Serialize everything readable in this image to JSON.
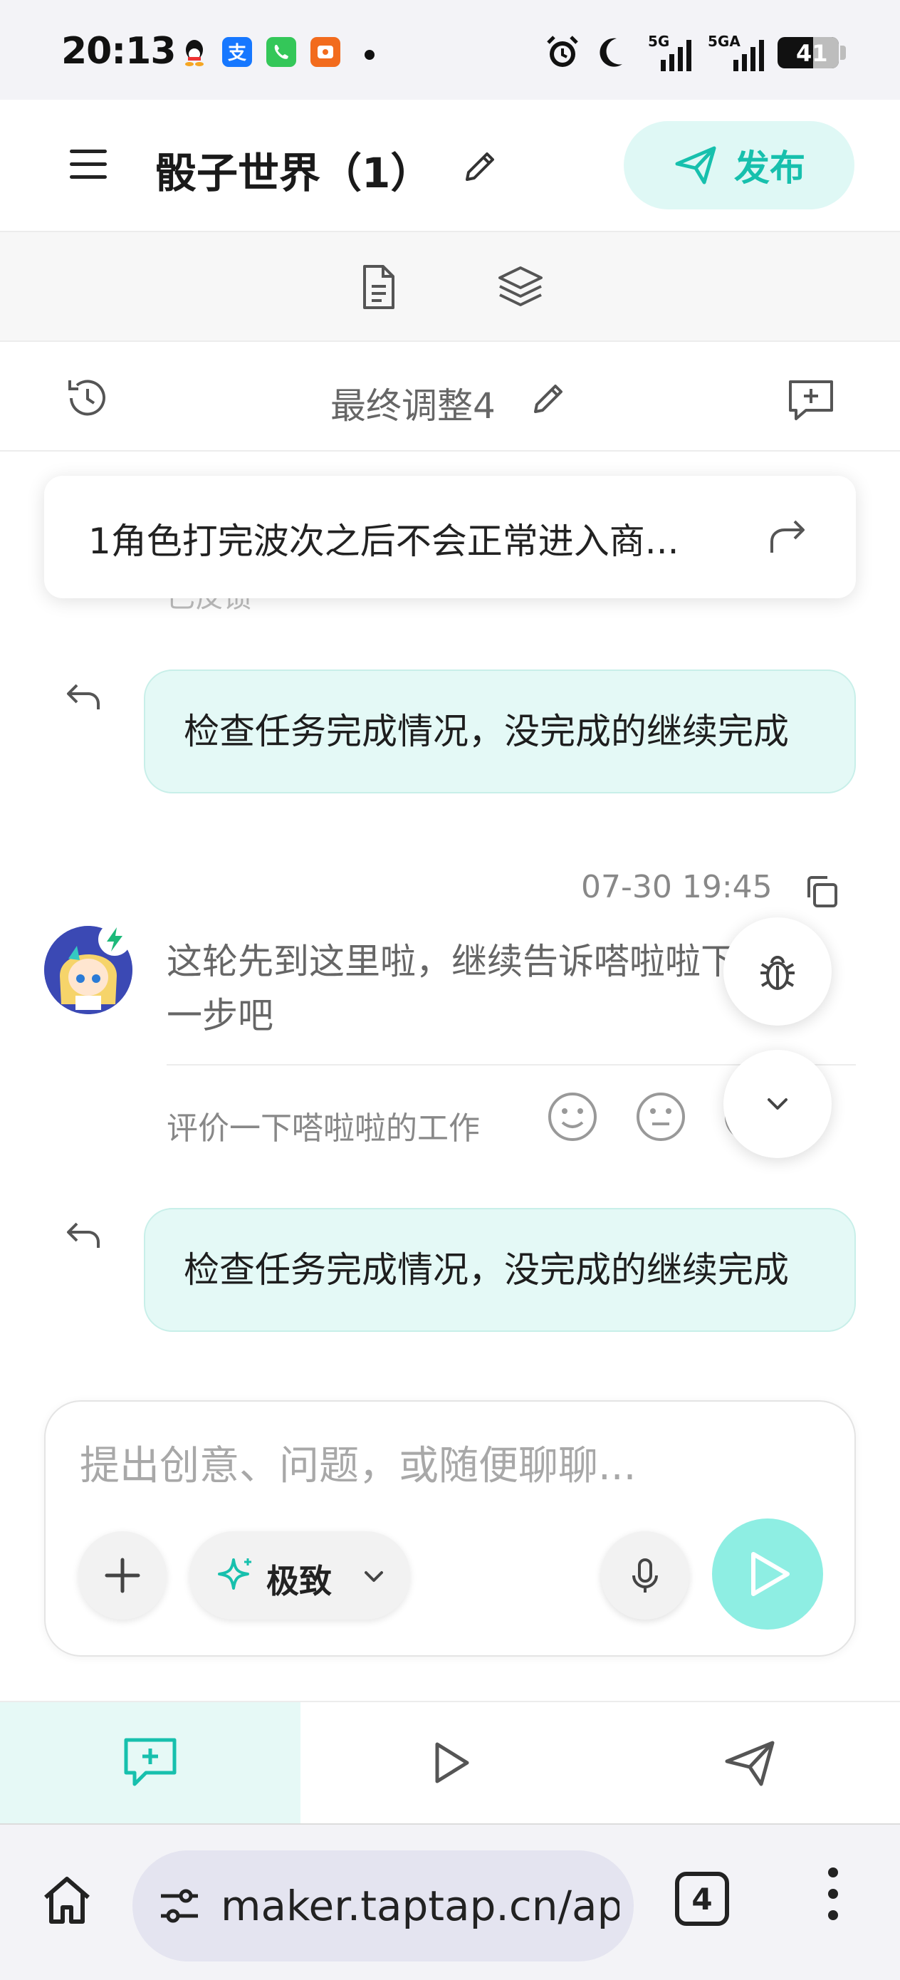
{
  "status_bar": {
    "time": "20:13",
    "net1": "5G",
    "net2": "5GA",
    "battery": "41",
    "icons": [
      "qq-icon",
      "alipay-icon",
      "phone-icon",
      "app-icon",
      "alarm-icon",
      "moon-icon",
      "signal-icon",
      "signal-icon"
    ]
  },
  "header": {
    "title": "骰子世界（1）",
    "publish_label": "发布"
  },
  "toolbar": {
    "icons": [
      "document-icon",
      "layers-icon"
    ]
  },
  "version": {
    "title": "最终调整4"
  },
  "chat": {
    "hidden_text": "已反馈",
    "pinned_text": "1角色打完波次之后不会正常进入商...",
    "messages": [
      {
        "role": "user",
        "text": "检查任务完成情况，没完成的继续完成"
      },
      {
        "role": "assistant",
        "time": "07-30 19:45",
        "text": "这轮先到这里啦，继续告诉嗒啦啦下一步吧",
        "rate_label": "评价一下嗒啦啦的工作"
      },
      {
        "role": "user",
        "text": "检查任务完成情况，没完成的继续完成"
      }
    ]
  },
  "composer": {
    "placeholder": "提出创意、问题，或随便聊聊...",
    "mode_label": "极致"
  },
  "bottom_tabs": [
    "chat-tab",
    "preview-tab",
    "publish-tab"
  ],
  "browser": {
    "url": "maker.taptap.cn/app",
    "tab_count": "4"
  },
  "colors": {
    "accent": "#17c0ad",
    "accent_light": "#dff8f5",
    "bubble": "#e4f9f6",
    "send": "#8eeee3"
  }
}
